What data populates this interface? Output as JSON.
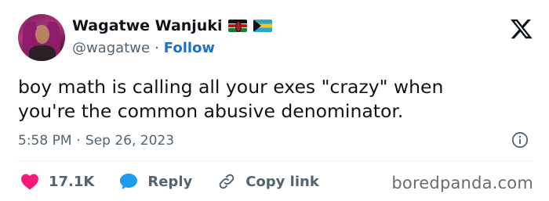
{
  "author": {
    "display_name": "Wagatwe Wanjuki",
    "handle": "@wagatwe",
    "separator": "·",
    "follow_label": "Follow",
    "flags": [
      "kenya-flag-icon",
      "bahamas-flag-icon"
    ]
  },
  "tweet": {
    "text": "boy math is calling all your exes \"crazy\" when\nyou're the common abusive denominator.",
    "time": "5:58 PM",
    "date_separator": "·",
    "date": "Sep 26, 2023"
  },
  "actions": {
    "like_count": "17.1K",
    "reply_label": "Reply",
    "copy_link_label": "Copy link"
  },
  "watermark": "boredpanda.com",
  "colors": {
    "like": "#f91880",
    "reply": "#1d9bf0",
    "follow": "#1d72c4",
    "secondary_text": "#536471"
  }
}
